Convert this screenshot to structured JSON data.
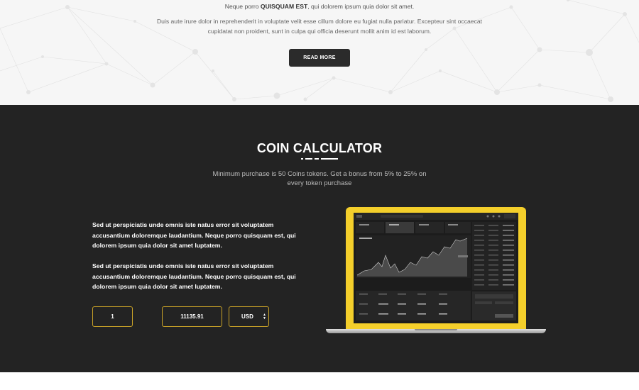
{
  "intro": {
    "line_prefix": "Neque porro ",
    "line_bold": "QUISQUAM EST",
    "line_suffix": ", qui dolorem ipsum quia dolor sit amet.",
    "paragraph": "Duis aute irure dolor in reprehenderit in voluptate velit esse cillum dolore eu fugiat nulla pariatur. Excepteur sint occaecat cupidatat non proident, sunt in culpa qui officia deserunt mollit anim id est laborum.",
    "read_more_label": "READ MORE"
  },
  "calculator": {
    "title": "COIN CALCULATOR",
    "subtitle": "Minimum purchase is 50 Coins tokens. Get a bonus from 5% to 25% on every token purchase",
    "text_1": "Sed ut perspiciatis unde omnis iste natus error sit voluptatem accusantium doloremque laudantium. Neque porro quisquam est, qui dolorem ipsum quia dolor sit amet luptatem.",
    "text_2": "Sed ut perspiciatis unde omnis iste natus error sit voluptatem accusantium doloremque laudantium. Neque porro quisquam est, qui dolorem ipsum quia dolor sit amet luptatem.",
    "quantity_value": "1",
    "result_value": "11135.91",
    "currency_selected": "USD"
  },
  "colors": {
    "dark_bg": "#232323",
    "accent_gold": "#c9a227",
    "laptop_yellow": "#f4cf2b",
    "button_dark": "#2b2b2b"
  }
}
